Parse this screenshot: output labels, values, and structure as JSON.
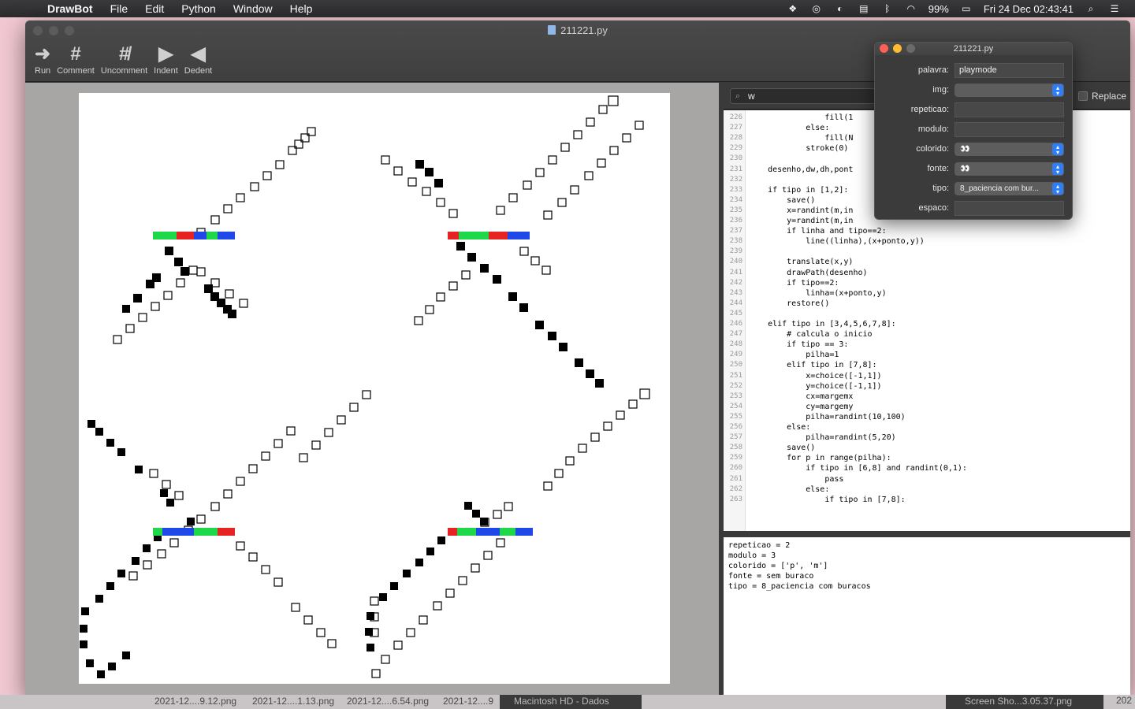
{
  "menubar": {
    "app_name": "DrawBot",
    "items": [
      "File",
      "Edit",
      "Python",
      "Window",
      "Help"
    ],
    "battery": "99%",
    "clock": "Fri 24 Dec  02:43:41"
  },
  "window": {
    "title": "211221.py",
    "toolbar": [
      {
        "label": "Run",
        "icon": "run-arrow-icon"
      },
      {
        "label": "Comment",
        "icon": "hash-icon"
      },
      {
        "label": "Uncomment",
        "icon": "hash-strike-icon"
      },
      {
        "label": "Indent",
        "icon": "indent-triangle-icon"
      },
      {
        "label": "Dedent",
        "icon": "dedent-triangle-icon"
      }
    ]
  },
  "search": {
    "value": "w",
    "replace_label": "Replace"
  },
  "editor": {
    "lines": [
      {
        "n": "226",
        "t": "                fill(1"
      },
      {
        "n": "227",
        "t": "            else:"
      },
      {
        "n": "228",
        "t": "                fill(N"
      },
      {
        "n": "229",
        "t": "            stroke(0)"
      },
      {
        "n": "230",
        "t": ""
      },
      {
        "n": "231",
        "t": "    desenho,dw,dh,pont"
      },
      {
        "n": "232",
        "t": ""
      },
      {
        "n": "233",
        "t": "    if tipo in [1,2]:"
      },
      {
        "n": "234",
        "t": "        save()"
      },
      {
        "n": "235",
        "t": "        x=randint(m,in"
      },
      {
        "n": "236",
        "t": "        y=randint(m,in"
      },
      {
        "n": "237",
        "t": "        if linha and tipo==2:"
      },
      {
        "n": "238",
        "t": "            line((linha),(x+ponto,y))"
      },
      {
        "n": "239",
        "t": ""
      },
      {
        "n": "240",
        "t": "        translate(x,y)"
      },
      {
        "n": "241",
        "t": "        drawPath(desenho)"
      },
      {
        "n": "242",
        "t": "        if tipo==2:"
      },
      {
        "n": "243",
        "t": "            linha=(x+ponto,y)"
      },
      {
        "n": "244",
        "t": "        restore()"
      },
      {
        "n": "245",
        "t": ""
      },
      {
        "n": "246",
        "t": "    elif tipo in [3,4,5,6,7,8]:"
      },
      {
        "n": "247",
        "t": "        # calcula o inicio"
      },
      {
        "n": "248",
        "t": "        if tipo == 3:"
      },
      {
        "n": "249",
        "t": "            pilha=1"
      },
      {
        "n": "250",
        "t": "        elif tipo in [7,8]:"
      },
      {
        "n": "251",
        "t": "            x=choice([-1,1])"
      },
      {
        "n": "252",
        "t": "            y=choice([-1,1])"
      },
      {
        "n": "253",
        "t": "            cx=margemx"
      },
      {
        "n": "254",
        "t": "            cy=margemy"
      },
      {
        "n": "255",
        "t": "            pilha=randint(10,100)"
      },
      {
        "n": "256",
        "t": "        else:"
      },
      {
        "n": "257",
        "t": "            pilha=randint(5,20)"
      },
      {
        "n": "258",
        "t": "        save()"
      },
      {
        "n": "259",
        "t": "        for p in range(pilha):"
      },
      {
        "n": "260",
        "t": "            if tipo in [6,8] and randint(0,1):"
      },
      {
        "n": "261",
        "t": "                pass"
      },
      {
        "n": "262",
        "t": "            else:"
      },
      {
        "n": "263",
        "t": "                if tipo in [7,8]:"
      }
    ]
  },
  "output": {
    "lines": [
      "repeticao = 2",
      "modulo = 3",
      "colorido = ['p', 'm']",
      "fonte = sem buraco",
      "tipo = 8_paciencia com buracos"
    ]
  },
  "variables": {
    "title": "211221.py",
    "fields": [
      {
        "label": "palavra:",
        "value": "playmode",
        "kind": "text"
      },
      {
        "label": "img:",
        "value": "",
        "kind": "select"
      },
      {
        "label": "repeticao:",
        "value": "",
        "kind": "text"
      },
      {
        "label": "modulo:",
        "value": "",
        "kind": "text"
      },
      {
        "label": "colorido:",
        "value": "👀",
        "kind": "select"
      },
      {
        "label": "fonte:",
        "value": "👀",
        "kind": "select"
      },
      {
        "label": "tipo:",
        "value": "8_paciencia com bur...",
        "kind": "select"
      },
      {
        "label": "espaco:",
        "value": "",
        "kind": "text"
      }
    ]
  },
  "dock": {
    "items": [
      "2021-12....9.12.png",
      "2021-12....1.13.png",
      "2021-12....6.54.png",
      "2021-12....9",
      "Macintosh HD - Dados",
      "Screen Sho...3.05.37.png",
      "202"
    ]
  }
}
